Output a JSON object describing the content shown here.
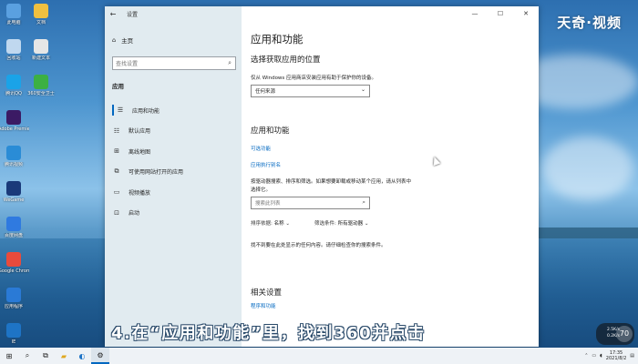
{
  "desktop_icons": [
    {
      "label": "此电脑",
      "color": "#5aa0e0"
    },
    {
      "label": "文档",
      "color": "#f0c040"
    },
    {
      "label": "回收站",
      "color": "#c0d8ef"
    },
    {
      "label": "新建文本",
      "color": "#e6e6e6"
    },
    {
      "label": "腾讯QQ",
      "color": "#1aa3e8"
    },
    {
      "label": "360安全卫士",
      "color": "#3cb043"
    },
    {
      "label": "Adobe Premiere Pro",
      "color": "#3b1a64"
    },
    {
      "label": "腾讯视频",
      "color": "#2a8cd6"
    },
    {
      "label": "WeGame",
      "color": "#1a3a7a"
    },
    {
      "label": "百度网盘",
      "color": "#2f7ae0"
    },
    {
      "label": "Google Chrome",
      "color": "#e94b3c"
    },
    {
      "label": "应用程序",
      "color": "#2a7ad6"
    },
    {
      "label": "IE",
      "color": "#1e74c6"
    }
  ],
  "window": {
    "title": "设置",
    "controls": {
      "minimize": "—",
      "maximize": "☐",
      "close": "✕"
    }
  },
  "sidebar": {
    "home": "主页",
    "search_placeholder": "查找设置",
    "section": "应用",
    "items": [
      {
        "label": "应用和功能",
        "icon": "apps-list-icon",
        "glyph": "☰"
      },
      {
        "label": "默认应用",
        "icon": "default-apps-icon",
        "glyph": "☷"
      },
      {
        "label": "离线地图",
        "icon": "map-icon",
        "glyph": "⊞"
      },
      {
        "label": "可使用网站打开的应用",
        "icon": "web-apps-icon",
        "glyph": "⧉"
      },
      {
        "label": "视频播放",
        "icon": "video-icon",
        "glyph": "▭"
      },
      {
        "label": "启动",
        "icon": "startup-icon",
        "glyph": "⊡"
      }
    ]
  },
  "main": {
    "title": "应用和功能",
    "install_heading": "选择获取应用的位置",
    "install_desc": "仅从 Windows 应用商店安装应用有助于保护你的设备。",
    "install_dropdown": "任何来源",
    "apps_heading": "应用和功能",
    "optional_features": "可选功能",
    "app_aliases": "应用执行别名",
    "filter_desc_line1": "按驱动器搜索、排序和筛选。如果想要卸载或移动某个应用，请从列表中",
    "filter_desc_line2": "选择它。",
    "list_search_placeholder": "搜索此列表",
    "sort_label": "排序依据:",
    "sort_value": "名称",
    "filter_label": "筛选条件:",
    "filter_value": "所有驱动器",
    "no_results": "找不到要在此处显示的任何内容。请仔细检查你的搜索条件。",
    "related_heading": "相关设置",
    "related_link": "程序和功能"
  },
  "overlay": {
    "watermark": "天奇·视频",
    "caption": "4.在“应用和功能”里，找到360并点击"
  },
  "net_widget": {
    "up": "2.5K/s",
    "down": "0.2K/s",
    "percent": "70"
  },
  "taskbar": {
    "time": "17:35",
    "date": "2021/8/2"
  }
}
